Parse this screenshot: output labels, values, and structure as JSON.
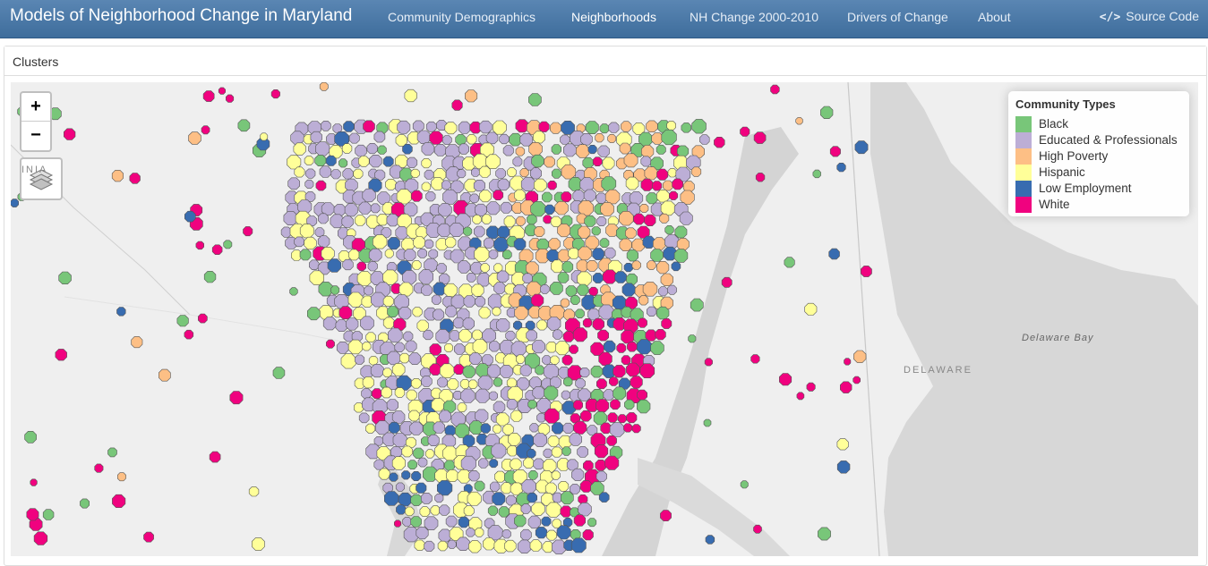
{
  "app_title": "Models of Neighborhood Change in Maryland",
  "nav": [
    {
      "label": "Community Demographics",
      "active": false
    },
    {
      "label": "Neighborhoods",
      "active": true
    },
    {
      "label": "NH Change 2000-2010",
      "active": false
    },
    {
      "label": "Drivers of Change",
      "active": false
    },
    {
      "label": "About",
      "active": false
    }
  ],
  "source_code": {
    "label": "Source Code",
    "icon": "code-icon"
  },
  "panel": {
    "title": "Clusters"
  },
  "map": {
    "zoom_in": "+",
    "zoom_out": "−",
    "layers_icon": "layers-icon",
    "labels": {
      "virginia": "INIA",
      "delaware": "DELAWARE",
      "bay": "Delaware Bay"
    }
  },
  "legend": {
    "title": "Community Types",
    "items": [
      {
        "label": "Black",
        "color": "#78c679"
      },
      {
        "label": "Educated & Professionals",
        "color": "#bcaed6"
      },
      {
        "label": "High Poverty",
        "color": "#fdbf85"
      },
      {
        "label": "Hispanic",
        "color": "#ffff99"
      },
      {
        "label": "Low Employment",
        "color": "#386cb0"
      },
      {
        "label": "White",
        "color": "#f0027f"
      }
    ]
  }
}
